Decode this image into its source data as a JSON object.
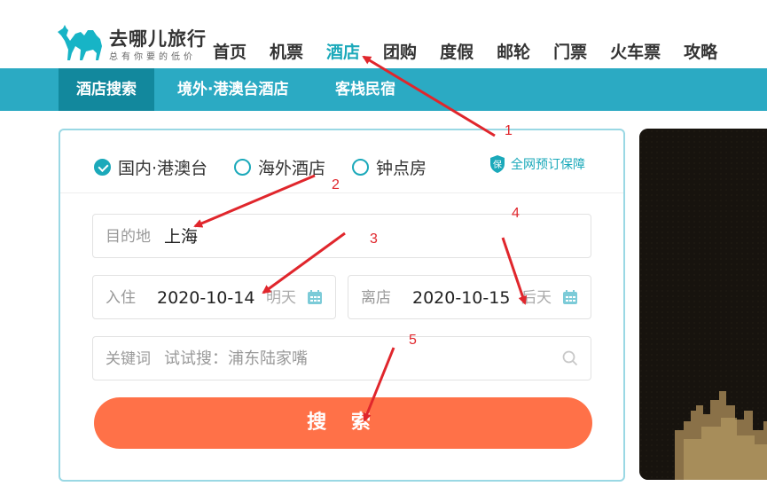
{
  "header": {
    "logo_title": "去哪儿旅行",
    "logo_slogan": "总有你要的低价",
    "nav_items": [
      {
        "label": "首页",
        "active": false
      },
      {
        "label": "机票",
        "active": false
      },
      {
        "label": "酒店",
        "active": true
      },
      {
        "label": "团购",
        "active": false
      },
      {
        "label": "度假",
        "active": false
      },
      {
        "label": "邮轮",
        "active": false
      },
      {
        "label": "门票",
        "active": false
      },
      {
        "label": "火车票",
        "active": false
      },
      {
        "label": "攻略",
        "active": false
      }
    ]
  },
  "sub_nav": {
    "items": [
      {
        "label": "酒店搜索",
        "active": true
      },
      {
        "label": "境外·港澳台酒店",
        "active": false
      },
      {
        "label": "客栈民宿",
        "active": false
      }
    ]
  },
  "search_panel": {
    "options": [
      {
        "label": "国内·港澳台",
        "checked": true
      },
      {
        "label": "海外酒店",
        "checked": false
      },
      {
        "label": "钟点房",
        "checked": false
      }
    ],
    "guarantee_label": "全网预订保障",
    "destination": {
      "label": "目的地",
      "value": "上海"
    },
    "checkin": {
      "label": "入住",
      "value": "2020-10-14",
      "hint": "明天"
    },
    "checkout": {
      "label": "离店",
      "value": "2020-10-15",
      "hint": "后天"
    },
    "keyword": {
      "label": "关键词",
      "placeholder": "试试搜：浦东陆家嘴"
    },
    "search_button": "搜 索"
  },
  "annotations": [
    "1",
    "2",
    "3",
    "4",
    "5"
  ],
  "colors": {
    "accent": "#1ba9ba",
    "subnav_bg": "#2baac3",
    "subnav_active": "#12889d",
    "button": "#ff7148",
    "annotation": "#e0262c"
  }
}
